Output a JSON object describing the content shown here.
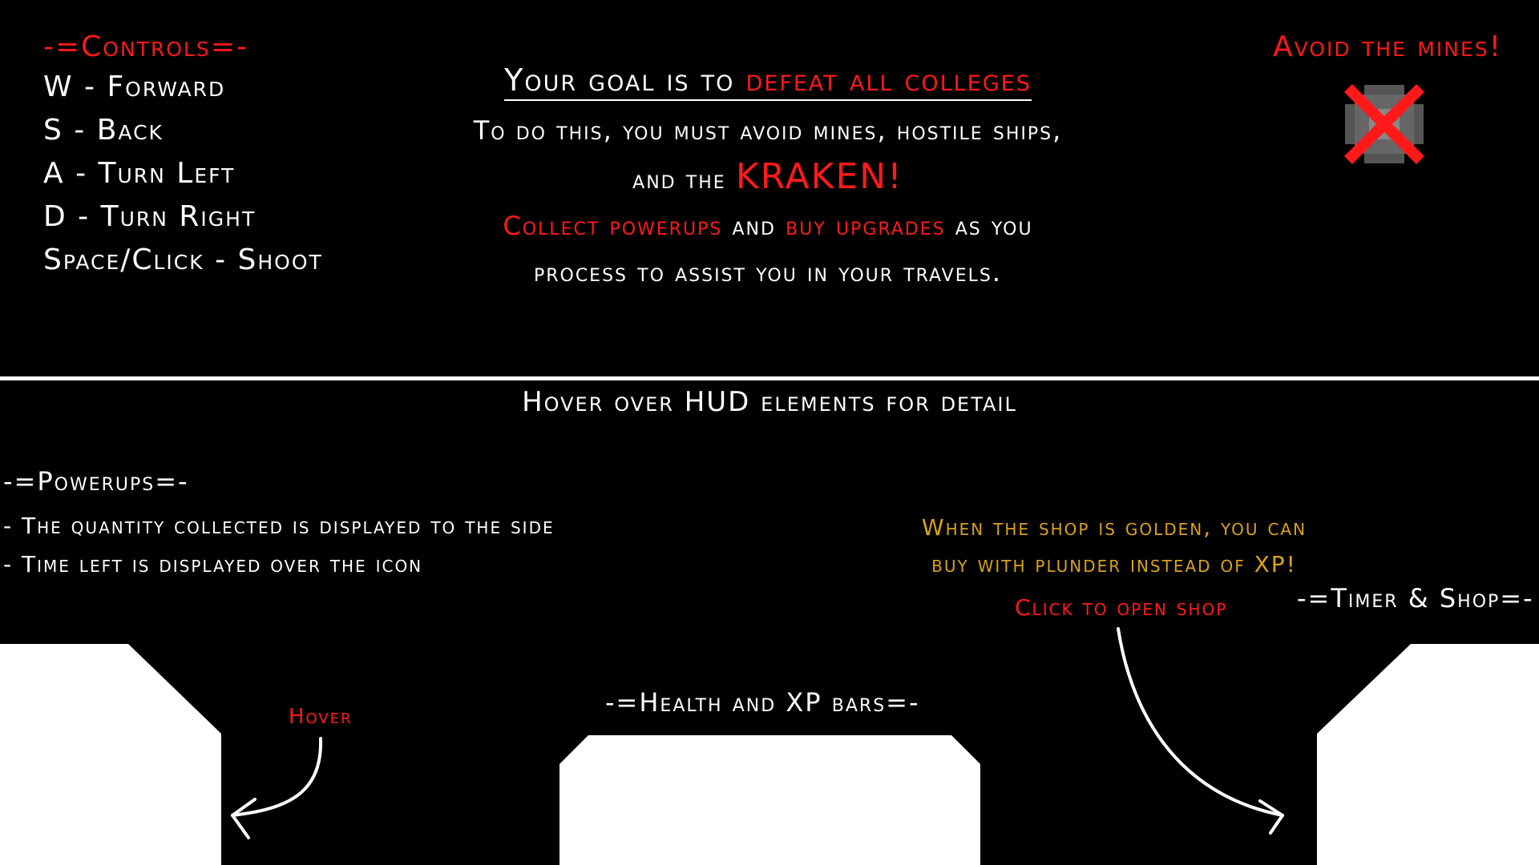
{
  "controls": {
    "title": "-=Controls=-",
    "items": [
      "W - Forward",
      "S - Back",
      "A - Turn Left",
      "D - Turn Right",
      "Space/Click - Shoot"
    ]
  },
  "goal": {
    "prefix": "Your goal is to ",
    "highlight": "defeat all colleges",
    "line2": "To do this, you must avoid mines, hostile ships,",
    "line3_prefix": "and the ",
    "line3_highlight": "KRAKEN!",
    "line4_part1": "Collect powerups",
    "line4_part2": " and ",
    "line4_part3": "buy upgrades",
    "line4_part4": " as you",
    "line5": "process to assist you in your travels."
  },
  "mines": {
    "title": "Avoid the mines!",
    "icon": "mine-crossed-icon"
  },
  "hud_hint": "Hover over HUD elements for detail",
  "powerups": {
    "title": "-=Powerups=-",
    "items": [
      "- The quantity collected is displayed to the side",
      "- Time left is displayed over the icon"
    ],
    "hover_label": "Hover"
  },
  "shop": {
    "note_line1": "When the shop is golden, you can",
    "note_line2": "buy with plunder instead of XP!",
    "click_label": "Click to open shop",
    "section_title": "-=Timer & Shop=-"
  },
  "health": {
    "title": "-=Health and XP bars=-"
  },
  "colors": {
    "accent_red": "#ff1a1a",
    "gold": "#d9a21b",
    "background": "#000000",
    "foreground": "#ffffff"
  }
}
